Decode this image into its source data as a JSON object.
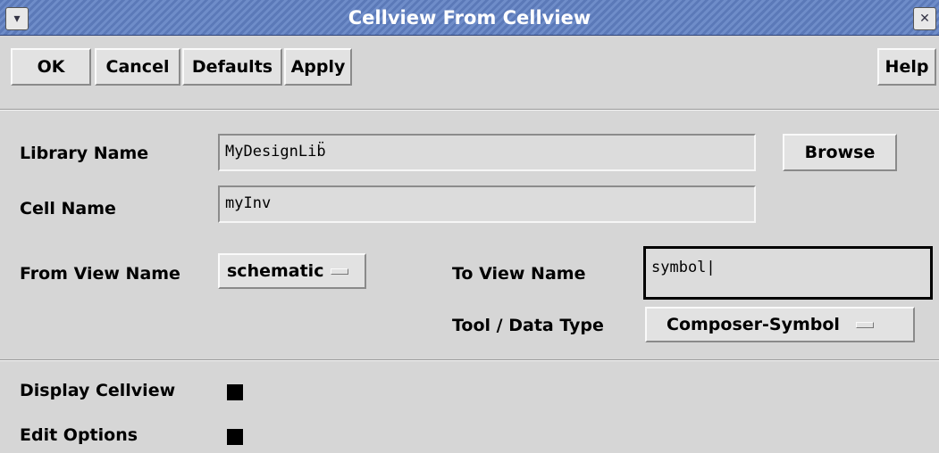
{
  "window": {
    "title": "Cellview From Cellview",
    "menu_icon": "chevron-down-icon",
    "close_icon": "close-icon",
    "close_glyph": "✕",
    "menu_glyph": "▾"
  },
  "toolbar": {
    "ok_label": "OK",
    "cancel_label": "Cancel",
    "defaults_label": "Defaults",
    "apply_label": "Apply",
    "help_label": "Help"
  },
  "form": {
    "library_name_label": "Library Name",
    "library_name_value": "MyDesignLib",
    "browse_label": "Browse",
    "cell_name_label": "Cell Name",
    "cell_name_value": "myInv",
    "from_view_label": "From View Name",
    "from_view_value": "schematic",
    "to_view_label": "To View Name",
    "to_view_value": "symbol",
    "tool_label": "Tool / Data Type",
    "tool_value": "Composer-Symbol"
  },
  "options": {
    "display_cellview_label": "Display Cellview",
    "display_cellview_checked": true,
    "edit_options_label": "Edit Options",
    "edit_options_checked": true
  },
  "colors": {
    "titlebar": "#5b79b8",
    "background": "#d6d6d6"
  }
}
